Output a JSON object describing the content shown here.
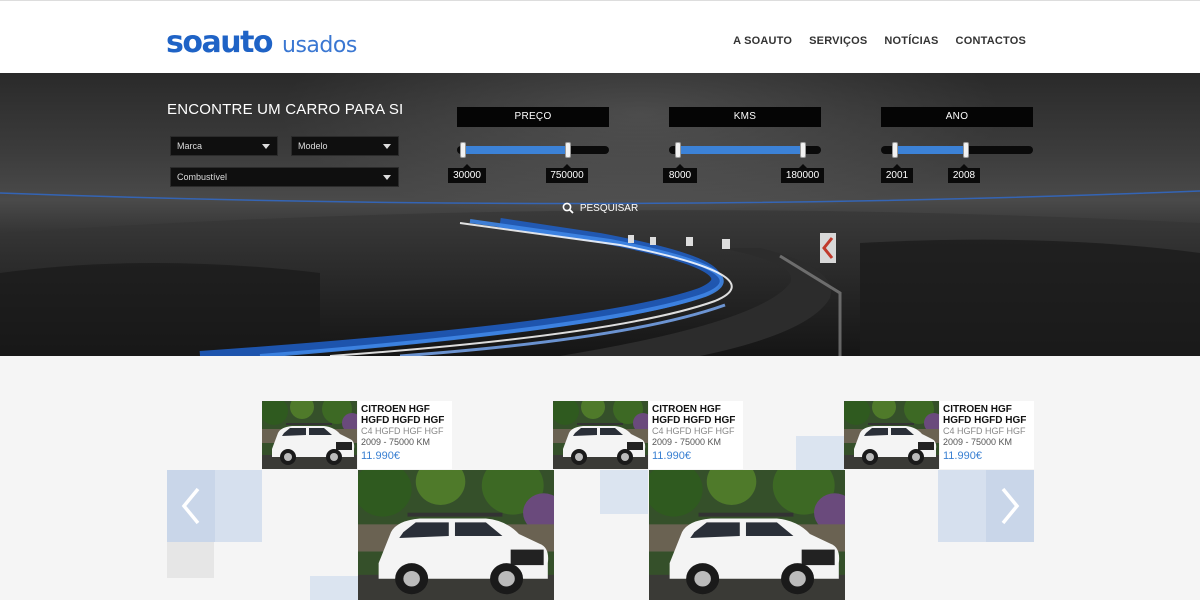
{
  "header": {
    "logo_main": "soauto",
    "logo_sub": "usados",
    "nav": [
      "A SOAUTO",
      "SERVIÇOS",
      "NOTÍCIAS",
      "CONTACTOS"
    ]
  },
  "hero": {
    "title": "ENCONTRE UM CARRO PARA SI",
    "selects": {
      "marca": "Marca",
      "modelo": "Modelo",
      "combustivel": "Combustível"
    },
    "filters": [
      {
        "label": "PREÇO",
        "min": "30000",
        "max": "750000"
      },
      {
        "label": "KMS",
        "min": "8000",
        "max": "180000"
      },
      {
        "label": "ANO",
        "min": "2001",
        "max": "2008"
      }
    ],
    "search_label": "PESQUISAR"
  },
  "listings": [
    {
      "name": "CITROEN HGF HGFD HGFD HGF",
      "model": "C4 HGFD HGF HGF",
      "meta": "2009 - 75000 KM",
      "price": "11.990€"
    },
    {
      "name": "CITROEN HGF HGFD HGFD HGF",
      "model": "C4 HGFD HGF HGF",
      "meta": "2009 - 75000 KM",
      "price": "11.990€"
    },
    {
      "name": "CITROEN HGF HGFD HGFD HGF",
      "model": "C4 HGFD HGF HGF",
      "meta": "2009 - 75000 KM",
      "price": "11.990€"
    }
  ],
  "colors": {
    "brand": "#1f63c6",
    "accent": "#3c82d7",
    "price": "#3a80d2"
  },
  "icons": {
    "search": "search-icon",
    "prev": "chevron-left-icon",
    "next": "chevron-right-icon",
    "caret": "caret-down-icon"
  }
}
